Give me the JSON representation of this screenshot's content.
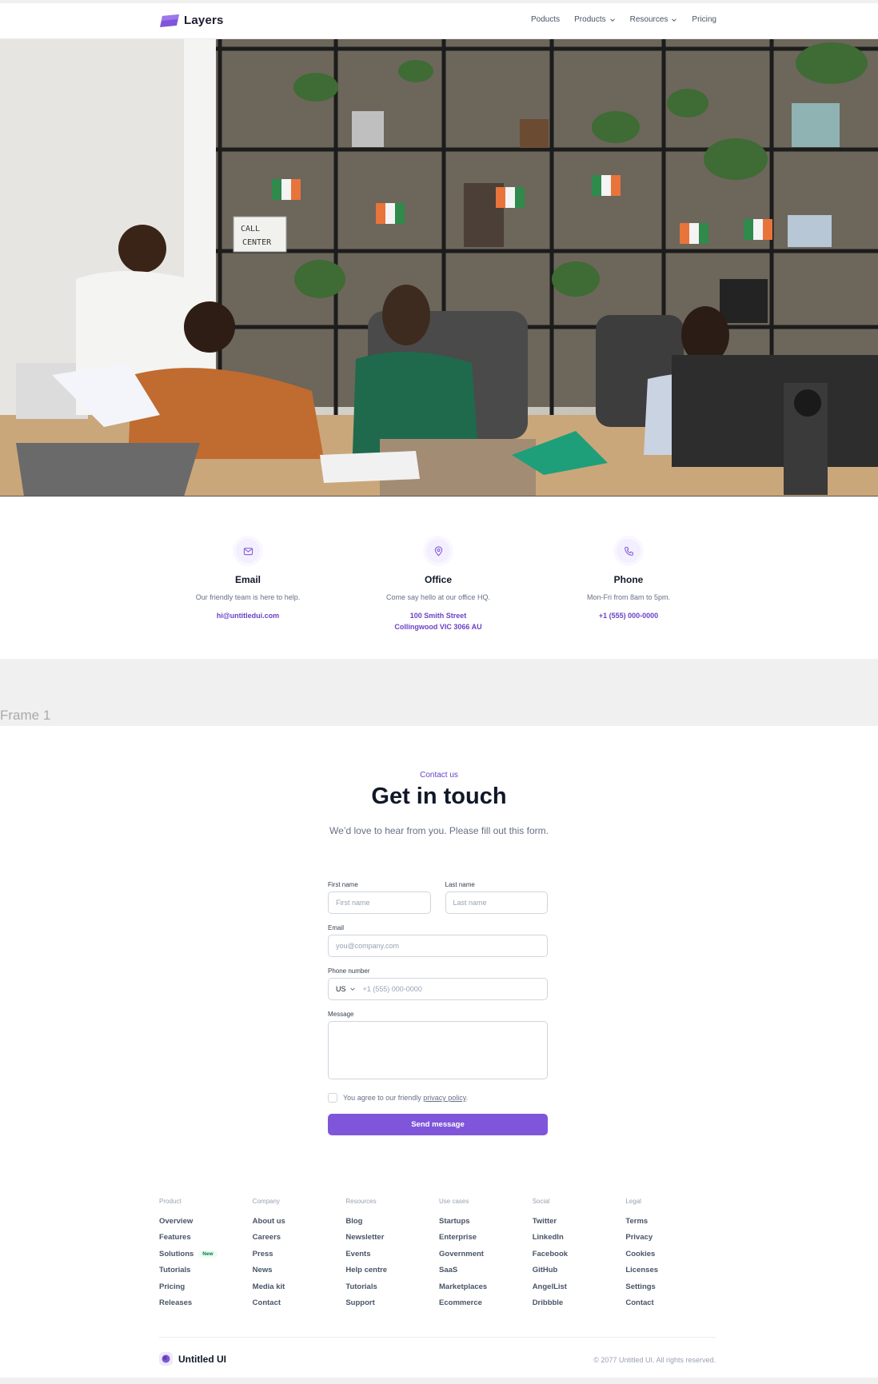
{
  "header": {
    "brand": "Layers",
    "nav": [
      {
        "label": "Poducts",
        "dropdown": false
      },
      {
        "label": "Products",
        "dropdown": true
      },
      {
        "label": "Resources",
        "dropdown": true
      },
      {
        "label": "Pricing",
        "dropdown": false
      }
    ]
  },
  "hero": {
    "sign_line1": "CALL",
    "sign_line2": "CENTER"
  },
  "contact_info": [
    {
      "icon": "mail-icon",
      "title": "Email",
      "desc": "Our friendly team is here to help.",
      "value": "hi@untitledui.com"
    },
    {
      "icon": "map-pin-icon",
      "title": "Office",
      "desc": "Come say hello at our office HQ.",
      "value": "100 Smith Street",
      "value2": "Collingwood VIC 3066 AU"
    },
    {
      "icon": "phone-icon",
      "title": "Phone",
      "desc": "Mon-Fri from 8am to 5pm.",
      "value": "+1 (555) 000-0000"
    }
  ],
  "frame_label": "Frame 1",
  "contact_form": {
    "eyebrow": "Contact us",
    "heading": "Get in touch",
    "subheading": "We’d love to hear from you. Please fill out this form.",
    "first_name_label": "First name",
    "first_name_placeholder": "First name",
    "last_name_label": "Last name",
    "last_name_placeholder": "Last name",
    "email_label": "Email",
    "email_placeholder": "you@company.com",
    "phone_label": "Phone number",
    "phone_country": "US",
    "phone_placeholder": "+1 (555) 000-0000",
    "message_label": "Message",
    "agree_prefix": "You agree to our friendly ",
    "agree_link": "privacy policy",
    "agree_suffix": ".",
    "submit_label": "Send message"
  },
  "footer": {
    "columns": [
      {
        "heading": "Product",
        "links": [
          "Overview",
          "Features",
          "Solutions",
          "Tutorials",
          "Pricing",
          "Releases"
        ],
        "badge_index": 2,
        "badge": "New"
      },
      {
        "heading": "Company",
        "links": [
          "About us",
          "Careers",
          "Press",
          "News",
          "Media kit",
          "Contact"
        ]
      },
      {
        "heading": "Resources",
        "links": [
          "Blog",
          "Newsletter",
          "Events",
          "Help centre",
          "Tutorials",
          "Support"
        ]
      },
      {
        "heading": "Use cases",
        "links": [
          "Startups",
          "Enterprise",
          "Government",
          "SaaS",
          "Marketplaces",
          "Ecommerce"
        ]
      },
      {
        "heading": "Social",
        "links": [
          "Twitter",
          "LinkedIn",
          "Facebook",
          "GitHub",
          "AngelList",
          "Dribbble"
        ]
      },
      {
        "heading": "Legal",
        "links": [
          "Terms",
          "Privacy",
          "Cookies",
          "Licenses",
          "Settings",
          "Contact"
        ]
      }
    ],
    "brand": "Untitled UI",
    "copyright": "© 2077 Untitled UI. All rights reserved."
  },
  "colors": {
    "accent": "#7f56d9",
    "accent_text": "#6941c6",
    "text_primary": "#101828",
    "text_muted": "#667085"
  }
}
